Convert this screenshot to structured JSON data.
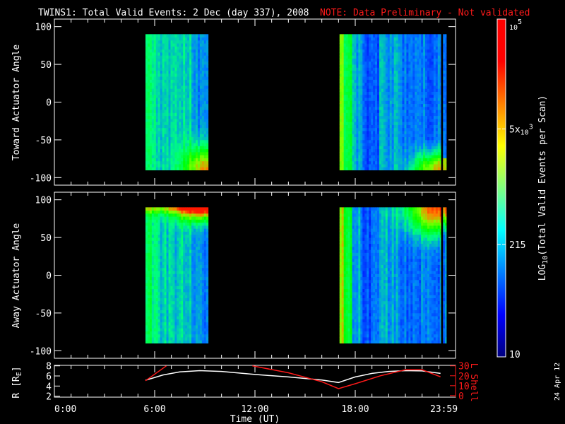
{
  "title": {
    "main": "TWINS1: Total Valid Events:  2 Dec (day 337), 2008",
    "note": "NOTE: Data Preliminary - Not validated"
  },
  "footer_date": "24 Apr 12",
  "colors": {
    "background": "#000000",
    "axes": "#ffffff",
    "note": "#ff1a1a",
    "lshell": "#ff1a1a",
    "r_line": "#ffffff"
  },
  "chart_data": [
    {
      "type": "heatmap",
      "name": "toward",
      "ylabel": "Toward Actuator Angle",
      "ylim": [
        -110,
        110
      ],
      "yticks": [
        "100",
        "50",
        "0",
        "-50",
        "-100"
      ],
      "ytick_values": [
        100,
        50,
        0,
        -50,
        -100
      ],
      "xlim_hours": [
        0,
        24
      ],
      "data_angle_range": [
        -90,
        90
      ],
      "coverage_hours": [
        [
          5.45,
          9.2
        ],
        [
          17.06,
          23.12
        ],
        [
          23.25,
          23.45
        ]
      ],
      "features": "mostly 100-500 events; enhanced counts (~5x10^3) at low angles after 7.5 UT and 21 UT"
    },
    {
      "type": "heatmap",
      "name": "away",
      "ylabel": "Away Actuator Angle",
      "ylim": [
        -110,
        110
      ],
      "yticks": [
        "100",
        "50",
        "0",
        "-50",
        "-100"
      ],
      "ytick_values": [
        100,
        50,
        0,
        -50,
        -100
      ],
      "xlim_hours": [
        0,
        24
      ],
      "data_angle_range": [
        -90,
        90
      ],
      "coverage_hours": [
        [
          5.45,
          9.2
        ],
        [
          17.06,
          23.12
        ],
        [
          23.25,
          23.45
        ]
      ],
      "features": "enhanced counts (~10^4) at high angles near 8-9 UT and 21-23 UT"
    },
    {
      "type": "line",
      "name": "orbit",
      "xlabel": "Time (UT)",
      "xticks": [
        "0:00",
        "6:00",
        "12:00",
        "18:00",
        "23:59"
      ],
      "xtick_values": [
        0,
        6,
        12,
        18,
        23.98
      ],
      "ylabel_left": "R [R",
      "ylabel_left_sub": "E",
      "ylabel_left_end": "]",
      "yticks_left": [
        "8",
        "6",
        "4",
        "2"
      ],
      "ytick_left_values": [
        8,
        6,
        4,
        2
      ],
      "ylim_left": [
        1.8,
        8.1
      ],
      "ylabel_right": "L Shell",
      "yticks_right": [
        "30",
        "20",
        "10",
        "0"
      ],
      "ytick_right_values": [
        30,
        20,
        10,
        0
      ],
      "ylim_right": [
        -1.5,
        30.5
      ],
      "series": [
        {
          "name": "R",
          "axis": "left",
          "x": [
            5.45,
            6.5,
            7.5,
            8.7,
            10,
            12,
            14,
            16,
            17.0,
            18,
            19,
            20,
            21,
            22,
            23.1
          ],
          "y": [
            5.15,
            6.2,
            6.8,
            7.05,
            6.9,
            6.3,
            5.8,
            5.2,
            4.7,
            5.8,
            6.5,
            6.9,
            7.05,
            7.0,
            6.5
          ]
        },
        {
          "name": "L Shell",
          "axis": "right",
          "x": [
            5.45,
            6.7
          ],
          "y": [
            15,
            30
          ]
        },
        {
          "name": "L Shell",
          "axis": "right",
          "x": [
            11.85,
            14,
            16,
            17.0,
            18,
            19.5,
            21,
            22,
            23.1
          ],
          "y": [
            30,
            23,
            14,
            7,
            12,
            20,
            26,
            26,
            19
          ]
        }
      ]
    },
    {
      "type": "colorbar",
      "name": "colorbar",
      "label": "LOG",
      "label_sub": "10",
      "label_rest": "(Total Valid Events per Scan)",
      "range": [
        10,
        100000
      ],
      "ticks": [
        {
          "value": 10,
          "label": "10"
        },
        {
          "value": 215,
          "label": "215"
        },
        {
          "value": 5000,
          "label": "5x",
          "base": "10",
          "exp": "3"
        },
        {
          "value": 100000,
          "label": "",
          "base": "10",
          "exp": "5"
        }
      ]
    }
  ]
}
